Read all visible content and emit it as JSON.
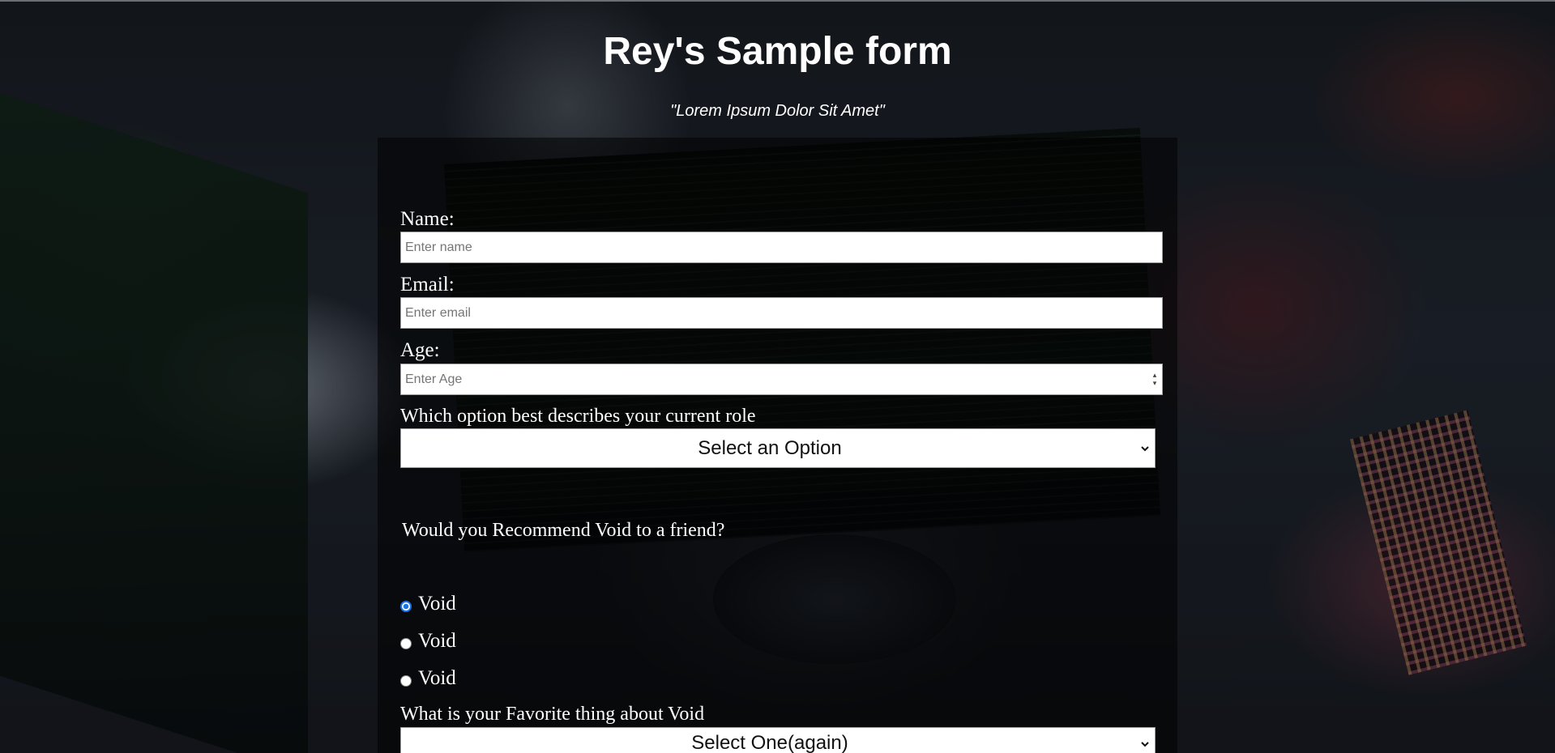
{
  "header": {
    "title": "Rey's Sample form",
    "subtitle": "\"Lorem Ipsum Dolor Sit Amet\""
  },
  "form": {
    "name": {
      "label": "Name:",
      "placeholder": "Enter name",
      "value": ""
    },
    "email": {
      "label": "Email:",
      "placeholder": "Enter email",
      "value": ""
    },
    "age": {
      "label": "Age:",
      "placeholder": "Enter Age",
      "value": ""
    },
    "role": {
      "label": "Which option best describes your current role",
      "selected": "Select an Option"
    },
    "recommend": {
      "question": "Would you Recommend Void to a friend?",
      "options": [
        {
          "label": "Void",
          "checked": true
        },
        {
          "label": "Void",
          "checked": false
        },
        {
          "label": "Void",
          "checked": false
        }
      ]
    },
    "favorite": {
      "label": "What is your Favorite thing about Void",
      "selected": "Select One(again)"
    }
  },
  "colors": {
    "radio_accent": "#1a73e8",
    "text": "#ffffff",
    "panel_overlay": "rgba(0,0,0,0.55)"
  }
}
